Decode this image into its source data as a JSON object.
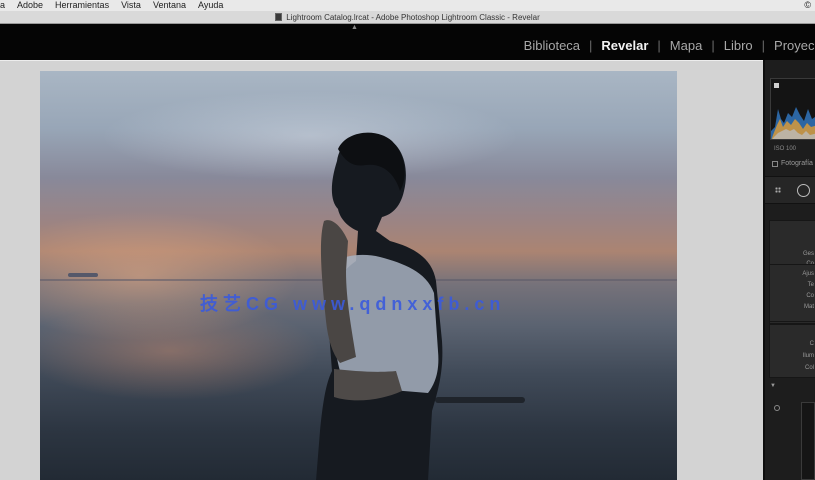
{
  "menubar": {
    "items": [
      "a",
      "Adobe",
      "Herramientas",
      "Vista",
      "Ventana",
      "Ayuda"
    ],
    "status_icon": "©"
  },
  "window": {
    "title": "Lightroom Catalog.lrcat - Adobe Photoshop Lightroom Classic - Revelar"
  },
  "modules": {
    "items": [
      {
        "label": "Biblioteca",
        "active": false
      },
      {
        "label": "Revelar",
        "active": true
      },
      {
        "label": "Mapa",
        "active": false
      },
      {
        "label": "Libro",
        "active": false
      },
      {
        "label": "Proyecc",
        "active": false
      }
    ],
    "separator": "|"
  },
  "watermark": {
    "text": "技艺CG  www.qdnxxfb.cn"
  },
  "right_panel": {
    "exif": "ISO 100",
    "original_label": "Fotografía",
    "block_labels": {
      "block1": [
        "Ges",
        "Co"
      ],
      "block2": [
        "Ajus",
        "Te",
        "Co",
        "Mat"
      ],
      "block3": [
        "C",
        "Ilum",
        "Col"
      ]
    }
  },
  "icons": {
    "dots": "grid-dots-icon",
    "circle": "spot-removal-icon",
    "triangle": "section-collapse-icon"
  },
  "colors": {
    "module_active": "#f2f2f2",
    "module_inactive": "#a8a8a8",
    "watermark": "#3b5bdc",
    "panel_bg": "#1d1d1d"
  }
}
